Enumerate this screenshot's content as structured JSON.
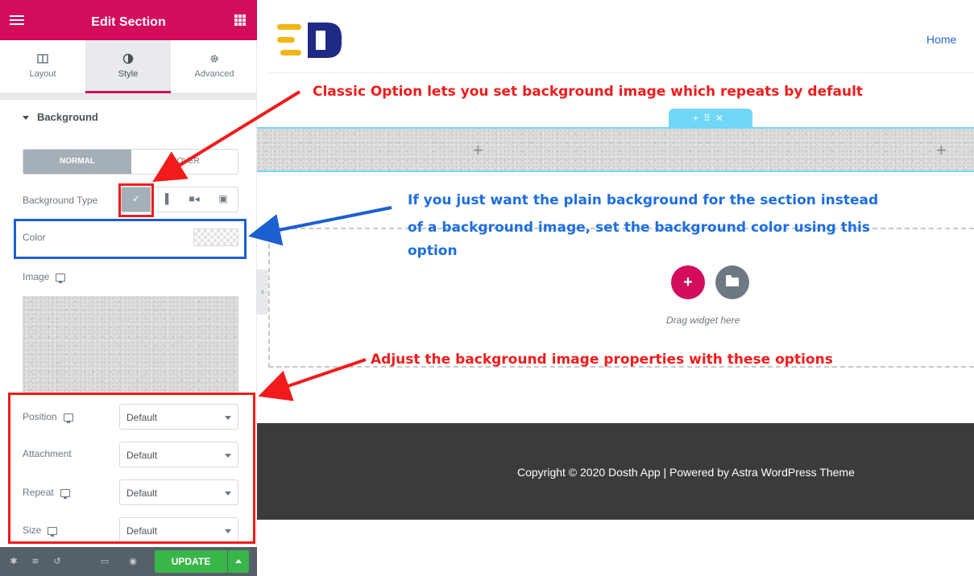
{
  "editor": {
    "title": "Edit Section",
    "tabs": [
      {
        "label": "Layout",
        "icon": "columns-icon"
      },
      {
        "label": "Style",
        "icon": "contrast-circle-icon"
      },
      {
        "label": "Advanced",
        "icon": "gear-icon"
      }
    ],
    "section_heading": "Background",
    "state_toggle": {
      "normal": "NORMAL",
      "hover": "HOVER"
    },
    "background_type_label": "Background Type",
    "background_type_options": [
      "classic-brush-icon",
      "gradient-icon",
      "video-icon",
      "slideshow-icon"
    ],
    "color_label": "Color",
    "image_label": "Image",
    "properties": [
      {
        "label": "Position",
        "value": "Default",
        "responsive": true
      },
      {
        "label": "Attachment",
        "value": "Default",
        "responsive": false
      },
      {
        "label": "Repeat",
        "value": "Default",
        "responsive": true
      },
      {
        "label": "Size",
        "value": "Default",
        "responsive": true
      }
    ],
    "footer": {
      "update_label": "UPDATE",
      "icons": [
        "settings-icon",
        "layers-icon",
        "history-icon",
        "responsive-icon",
        "preview-eye-icon"
      ]
    }
  },
  "canvas": {
    "nav_home": "Home",
    "section_handle": {
      "add": "+",
      "move": "⠿",
      "close": "✕"
    },
    "drag_text": "Drag widget here",
    "copyright": "Copyright © 2020 Dosth App | Powered by Astra WordPress Theme"
  },
  "annotations": {
    "classic": "Classic Option lets you set background image which repeats by default",
    "color_line1": "If you just want the plain background for the section instead",
    "color_line2": "of a background image, set the background color using this",
    "color_line3": "option",
    "properties": "Adjust the background image properties with these options"
  },
  "colors": {
    "brand": "#d30c5c",
    "update": "#39b54a",
    "handle": "#71d7f7",
    "annotation_red": "#f11b1b",
    "annotation_blue": "#1d6ee0"
  }
}
